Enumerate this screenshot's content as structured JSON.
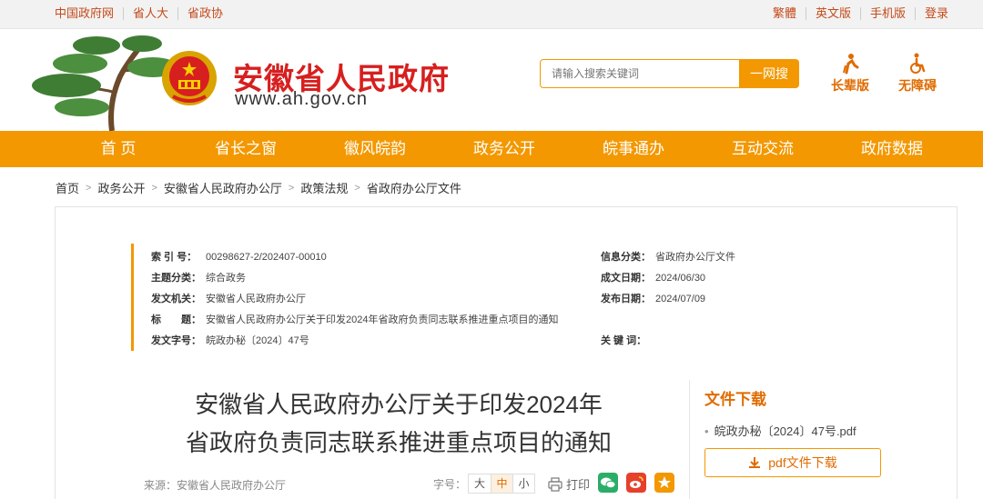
{
  "topbar": {
    "left_links": [
      "中国政府网",
      "省人大",
      "省政协"
    ],
    "right_links": [
      "繁體",
      "英文版",
      "手机版",
      "登录"
    ]
  },
  "header": {
    "site_title": "安徽省人民政府",
    "site_url": "www.ah.gov.cn",
    "search_placeholder": "请输入搜索关键词",
    "search_button": "一网搜",
    "elder_mode": "长辈版",
    "accessibility_mode": "无障碍"
  },
  "nav": {
    "items": [
      "首 页",
      "省长之窗",
      "徽风皖韵",
      "政务公开",
      "皖事通办",
      "互动交流",
      "政府数据"
    ]
  },
  "breadcrumb": [
    "首页",
    "政务公开",
    "安徽省人民政府办公厅",
    "政策法规",
    "省政府办公厅文件"
  ],
  "meta": {
    "index_label": "索 引 号：",
    "index_value": "00298627-2/202407-00010",
    "category_label": "信息分类：",
    "category_value": "省政府办公厅文件",
    "topic_label": "主题分类：",
    "topic_value": "综合政务",
    "date_written_label": "成文日期：",
    "date_written_value": "2024/06/30",
    "issuer_label": "发文机关：",
    "issuer_value": "安徽省人民政府办公厅",
    "published_label": "发布日期：",
    "published_value": "2024/07/09",
    "title_label": "标　　题：",
    "title_value": "安徽省人民政府办公厅关于印发2024年省政府负责同志联系推进重点项目的通知",
    "doc_no_label": "发文字号：",
    "doc_no_value": "皖政办秘〔2024〕47号",
    "keywords_label": "关 键 词：",
    "keywords_value": ""
  },
  "article": {
    "title_line1": "安徽省人民政府办公厅关于印发2024年",
    "title_line2": "省政府负责同志联系推进重点项目的通知",
    "source": "来源：安徽省人民政府办公厅",
    "fontsize_label": "字号：",
    "fontsize_options": [
      "大",
      "中",
      "小"
    ],
    "fontsize_selected": "中",
    "print_label": "打印"
  },
  "download": {
    "title": "文件下载",
    "file_name": "皖政办秘〔2024〕47号.pdf",
    "button_label": "pdf文件下载"
  },
  "colors": {
    "accent": "#f39800",
    "title_red": "#d71f1f",
    "orange_text": "#e06b00",
    "wechat": "#2aae67",
    "weibo": "#e6402b",
    "favorite": "#f39800"
  }
}
